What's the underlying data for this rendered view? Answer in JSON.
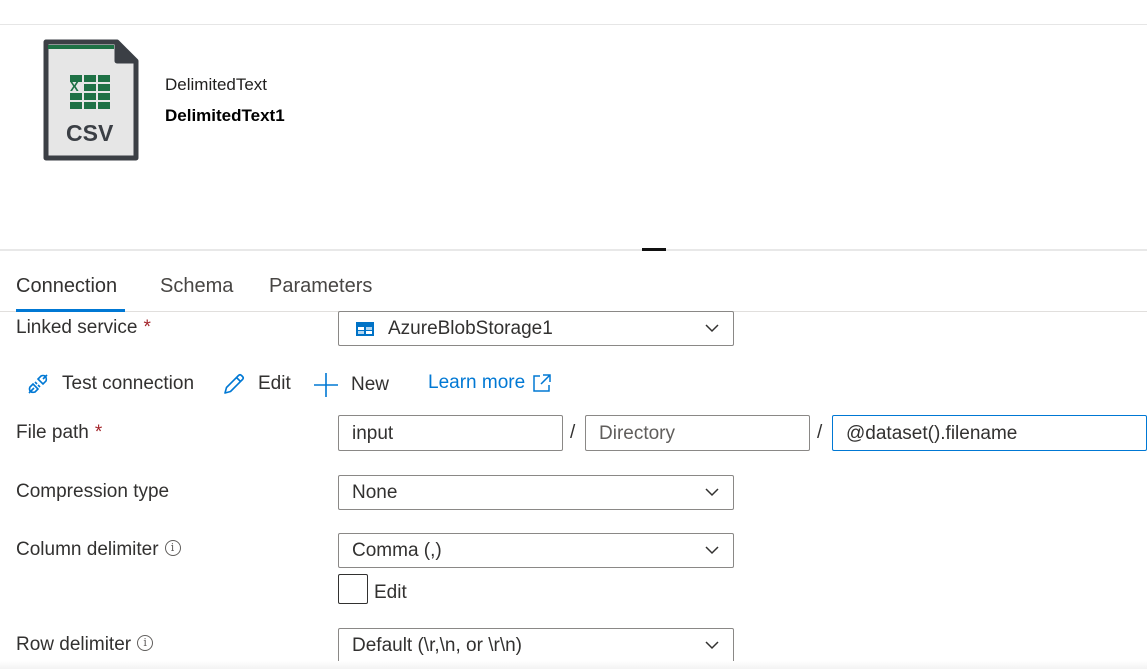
{
  "dataset": {
    "icon": "csv-file-icon",
    "icon_text": "CSV",
    "type": "DelimitedText",
    "name": "DelimitedText1"
  },
  "tabs": [
    {
      "label": "Connection",
      "active": true
    },
    {
      "label": "Schema",
      "active": false
    },
    {
      "label": "Parameters",
      "active": false
    }
  ],
  "connection": {
    "linked_service": {
      "label": "Linked service",
      "required": "*",
      "value": "AzureBlobStorage1",
      "icon": "storage-account-icon"
    },
    "actions": {
      "test_connection": "Test connection",
      "edit": "Edit",
      "new": "New",
      "learn_more": "Learn more"
    },
    "file_path": {
      "label": "File path",
      "required": "*",
      "container": "input",
      "directory_placeholder": "Directory",
      "file": "@dataset().filename",
      "separator": "/"
    },
    "compression_type": {
      "label": "Compression type",
      "value": "None"
    },
    "column_delimiter": {
      "label": "Column delimiter",
      "info": "i",
      "value": "Comma (,)",
      "edit_label": "Edit"
    },
    "row_delimiter": {
      "label": "Row delimiter",
      "info": "i",
      "value": "Default (\\r,\\n, or \\r\\n)"
    }
  },
  "colors": {
    "accent": "#0078d4",
    "required": "#a4262c",
    "excel_green": "#1e7145"
  }
}
